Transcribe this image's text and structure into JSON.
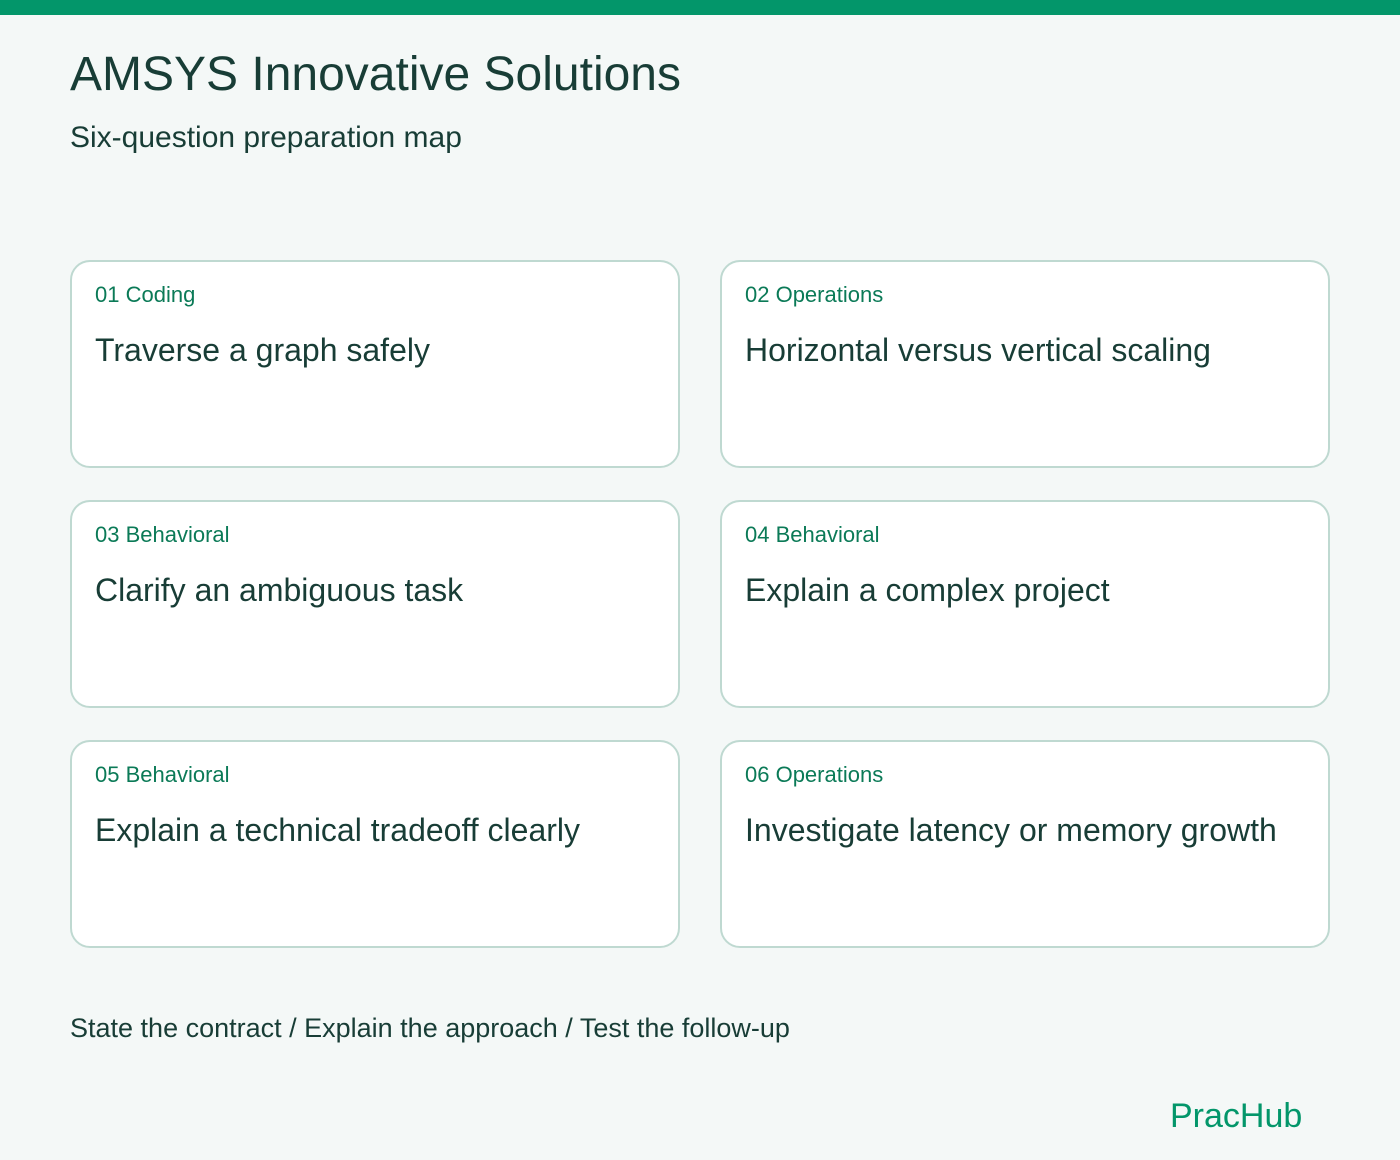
{
  "header": {
    "title": "AMSYS Innovative Solutions",
    "subtitle": "Six-question preparation map"
  },
  "cards": [
    {
      "tag": "01 Coding",
      "title": "Traverse a graph safely"
    },
    {
      "tag": "02 Operations",
      "title": "Horizontal versus vertical scaling"
    },
    {
      "tag": "03 Behavioral",
      "title": "Clarify an ambiguous task"
    },
    {
      "tag": "04 Behavioral",
      "title": "Explain a complex project"
    },
    {
      "tag": "05 Behavioral",
      "title": "Explain a technical tradeoff clearly"
    },
    {
      "tag": "06 Operations",
      "title": "Investigate latency or memory growth"
    }
  ],
  "footer": {
    "steps": "State the contract / Explain the approach / Test the follow-up",
    "brand": "PracHub"
  },
  "colors": {
    "accent": "#03966a",
    "text": "#183d36",
    "tag": "#0b7a57",
    "card_border": "#bfd9d1",
    "background": "#f4f8f7"
  }
}
